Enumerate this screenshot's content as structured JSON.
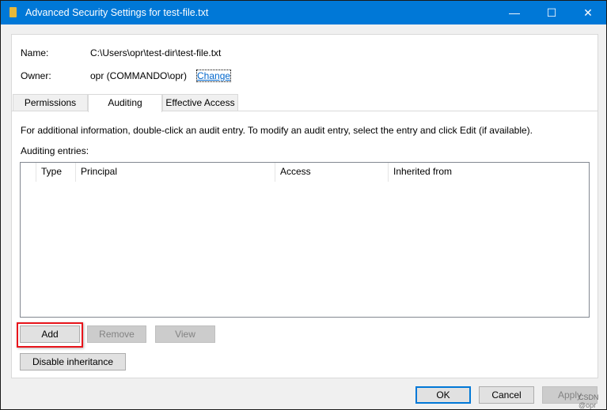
{
  "window": {
    "title": "Advanced Security Settings for test-file.txt",
    "minimize": "—",
    "maximize": "☐",
    "close": "✕"
  },
  "info": {
    "name_label": "Name:",
    "name_value": "C:\\Users\\opr\\test-dir\\test-file.txt",
    "owner_label": "Owner:",
    "owner_value": "opr (COMMANDO\\opr)",
    "change_link": "Change"
  },
  "tabs": [
    {
      "label": "Permissions"
    },
    {
      "label": "Auditing",
      "selected": true
    },
    {
      "label": "Effective Access"
    }
  ],
  "auditing": {
    "instructions": "For additional information, double-click an audit entry. To modify an audit entry, select the entry and click Edit (if available).",
    "entries_label": "Auditing entries:",
    "columns": [
      "Type",
      "Principal",
      "Access",
      "Inherited from"
    ],
    "rows": []
  },
  "buttons": {
    "add": "Add",
    "remove": "Remove",
    "view": "View",
    "disable_inheritance": "Disable inheritance",
    "ok": "OK",
    "cancel": "Cancel",
    "apply": "Apply"
  },
  "watermark": "CSDN @opr"
}
